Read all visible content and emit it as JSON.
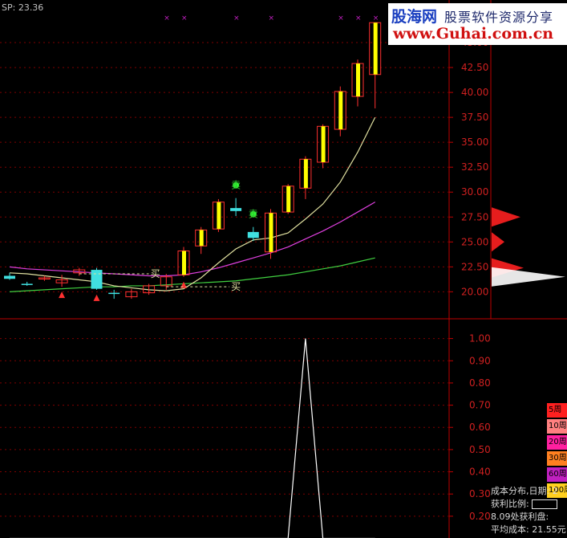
{
  "header": {
    "label": "SP: 23.36"
  },
  "watermark": {
    "site_cn": "股海网",
    "slogan": "股票软件资源分享",
    "url": "www.Guhai.com.cn"
  },
  "axis_upper": {
    "labels": [
      "45.00",
      "42.50",
      "40.00",
      "37.50",
      "35.00",
      "32.50",
      "30.00",
      "27.50",
      "25.00",
      "22.50",
      "20.00"
    ]
  },
  "axis_lower": {
    "labels": [
      "1.00",
      "0.90",
      "0.80",
      "0.70",
      "0.60",
      "0.50",
      "0.40",
      "0.30",
      "0.20"
    ]
  },
  "signals": {
    "buy": "买",
    "sell": "卖"
  },
  "legend": [
    {
      "label": "5周",
      "color": "#ff2020"
    },
    {
      "label": "10周",
      "color": "#ff8080"
    },
    {
      "label": "20周",
      "color": "#ff20a0"
    },
    {
      "label": "30周",
      "color": "#ff8020"
    },
    {
      "label": "60周",
      "color": "#c020c0"
    },
    {
      "label": "100周",
      "color": "#ffd020"
    }
  ],
  "info": {
    "title": "成本分布,日期: 2",
    "profit_ratio_label": "获利比例:",
    "profit_line": "8.09处获利盘:",
    "avg_cost": "平均成本: 21.55元"
  },
  "colors": {
    "up": "#ff3030",
    "down": "#40e0e0",
    "ma_short": "#e0e0a0",
    "ma_mid": "#e040e0",
    "ma_long": "#40d040",
    "separator": "#c00000",
    "highlight": "#ffff00"
  },
  "chart_data": [
    {
      "type": "candlestick",
      "ylim": [
        18.5,
        47.5
      ],
      "candles": [
        {
          "o": 21.6,
          "h": 21.9,
          "l": 21.2,
          "c": 21.3
        },
        {
          "o": 20.8,
          "h": 21.0,
          "l": 20.6,
          "c": 20.7
        },
        {
          "o": 21.3,
          "h": 21.6,
          "l": 21.1,
          "c": 21.4
        },
        {
          "o": 20.9,
          "h": 21.7,
          "l": 20.5,
          "c": 21.2
        },
        {
          "o": 21.9,
          "h": 22.4,
          "l": 21.6,
          "c": 22.2
        },
        {
          "o": 22.2,
          "h": 22.4,
          "l": 20.2,
          "c": 20.3
        },
        {
          "o": 19.9,
          "h": 20.2,
          "l": 19.3,
          "c": 19.8
        },
        {
          "o": 19.5,
          "h": 20.3,
          "l": 19.3,
          "c": 20.0
        },
        {
          "o": 19.9,
          "h": 20.8,
          "l": 19.7,
          "c": 20.6
        },
        {
          "o": 20.6,
          "h": 21.8,
          "l": 20.2,
          "c": 21.5
        },
        {
          "o": 21.7,
          "h": 24.5,
          "l": 21.5,
          "c": 24.1
        },
        {
          "o": 24.6,
          "h": 26.5,
          "l": 23.8,
          "c": 26.2
        },
        {
          "o": 26.3,
          "h": 29.3,
          "l": 26.0,
          "c": 29.0
        },
        {
          "o": 28.4,
          "h": 29.4,
          "l": 27.6,
          "c": 28.1
        },
        {
          "o": 26.0,
          "h": 26.5,
          "l": 25.1,
          "c": 25.4
        },
        {
          "o": 24.0,
          "h": 28.3,
          "l": 23.3,
          "c": 27.9
        },
        {
          "o": 28.0,
          "h": 30.8,
          "l": 27.8,
          "c": 30.6
        },
        {
          "o": 30.4,
          "h": 33.6,
          "l": 29.3,
          "c": 33.3
        },
        {
          "o": 33.0,
          "h": 36.8,
          "l": 32.4,
          "c": 36.6
        },
        {
          "o": 36.3,
          "h": 40.6,
          "l": 35.6,
          "c": 40.1
        },
        {
          "o": 39.6,
          "h": 43.3,
          "l": 38.6,
          "c": 42.9
        },
        {
          "o": 41.8,
          "h": 46.6,
          "l": 38.4,
          "c": 47.0
        }
      ],
      "ma_short": [
        21.9,
        21.8,
        21.6,
        21.4,
        21.2,
        21.0,
        20.6,
        20.4,
        20.2,
        20.1,
        20.3,
        21.4,
        22.9,
        24.3,
        25.2,
        25.4,
        25.9,
        27.3,
        28.8,
        31.0,
        34.0,
        37.5
      ],
      "ma_mid": [
        22.5,
        22.3,
        22.2,
        22.1,
        22.0,
        21.9,
        21.8,
        21.7,
        21.6,
        21.6,
        21.7,
        22.0,
        22.4,
        22.9,
        23.4,
        23.9,
        24.5,
        25.3,
        26.1,
        27.0,
        28.0,
        29.0
      ],
      "ma_long": [
        20.0,
        20.1,
        20.2,
        20.3,
        20.4,
        20.5,
        20.5,
        20.6,
        20.6,
        20.7,
        20.8,
        20.9,
        21.0,
        21.1,
        21.3,
        21.5,
        21.7,
        22.0,
        22.3,
        22.6,
        23.0,
        23.4
      ],
      "buy_markers": [
        3,
        5,
        10
      ],
      "sell_markers": [
        13,
        14
      ],
      "top_marks": [
        9,
        10,
        13,
        15,
        19,
        20,
        21,
        22
      ]
    },
    {
      "type": "line",
      "ylim": [
        0.12,
        1.06
      ],
      "values": [
        0.1,
        0.1,
        0.1,
        0.1,
        0.1,
        0.1,
        0.1,
        0.1,
        0.1,
        0.1,
        0.1,
        0.1,
        0.1,
        0.1,
        0.1,
        0.1,
        0.1,
        1.0,
        0.1,
        0.1,
        0.1,
        0.1
      ]
    },
    {
      "type": "distribution",
      "peaks": [
        {
          "price": 27.5,
          "width": 36,
          "color": "#ff2020"
        },
        {
          "price": 25.0,
          "width": 16,
          "color": "#ff2020"
        },
        {
          "price": 22.4,
          "width": 40,
          "color": "#ff2020"
        },
        {
          "price": 21.5,
          "width": 92,
          "color": "#ffffff"
        }
      ]
    }
  ]
}
